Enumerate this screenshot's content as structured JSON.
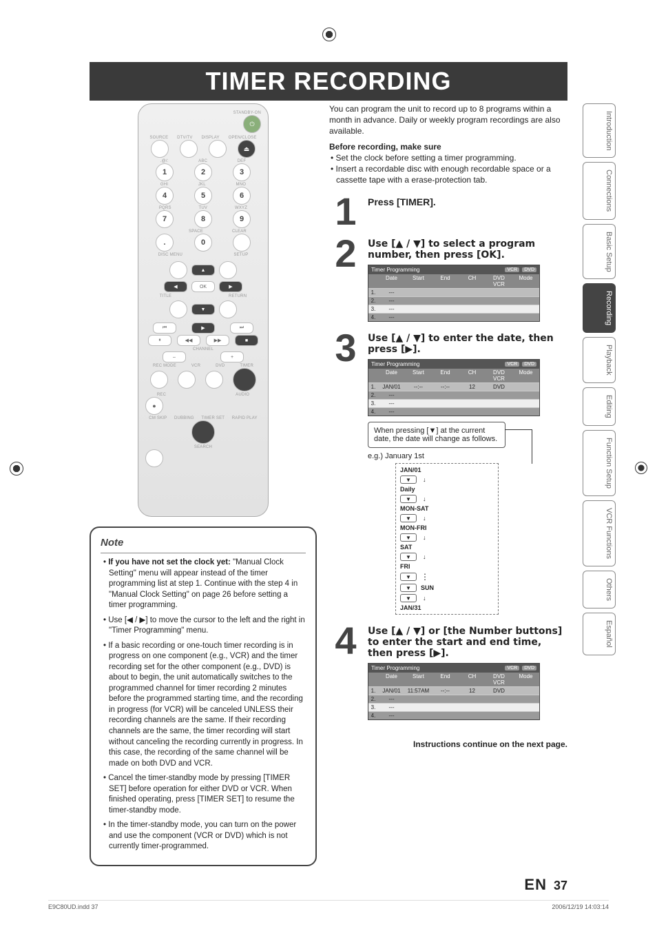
{
  "banner": {
    "title": "TIMER RECORDING"
  },
  "remote": {
    "labels": {
      "standby": "STANDBY-ON",
      "row1": [
        "SOURCE",
        "DTV/TV",
        "DISPLAY",
        "OPEN/CLOSE"
      ],
      "numrow1_lbl": [
        ".@/:",
        "ABC",
        "DEF"
      ],
      "numrow2_lbl": [
        "GHI",
        "JKL",
        "MNO"
      ],
      "numrow3_lbl": [
        "PQRS",
        "TUV",
        "WXYZ"
      ],
      "numrow4_lbl": [
        "",
        "SPACE",
        "CLEAR"
      ],
      "nums": [
        "1",
        "2",
        "3",
        "4",
        "5",
        "6",
        "7",
        "8",
        "9",
        ".",
        "0",
        ""
      ],
      "discmenu": "DISC MENU",
      "setup": "SETUP",
      "ok": "OK",
      "title": "TITLE",
      "return": "RETURN",
      "playrow": [
        "⏮",
        "▶",
        "⏭"
      ],
      "ctrlrow": [
        "⏸",
        "◀◀",
        "▶▶",
        "■"
      ],
      "channel": "CHANNEL",
      "minus": "–",
      "plus": "+",
      "recmode": "REC MODE",
      "vcr": "VCR",
      "dvd": "DVD",
      "timer": "TIMER",
      "rec": "REC",
      "audio": "AUDIO",
      "cmskip": "CM SKIP",
      "dubbing": "DUBBING",
      "timerset": "TIMER SET",
      "rapid": "RAPID PLAY",
      "search": "SEARCH"
    }
  },
  "note": {
    "heading": "Note",
    "bold1": "If you have not set the clock yet:",
    "item1": "\"Manual Clock Setting\" menu will appear instead of the timer programming list at step 1. Continue with the step 4 in \"Manual Clock Setting\" on page 26 before setting a timer programming.",
    "item2": "Use [◀ / ▶] to move the cursor to the left and the right in \"Timer Programming\" menu.",
    "item3": "If a basic recording or one-touch timer recording is in progress on one component (e.g., VCR) and the timer recording set for the other component (e.g., DVD) is about to begin, the unit automatically switches to the programmed channel for timer recording 2 minutes before the programmed starting time, and the recording in progress (for VCR) will be canceled UNLESS their recording channels are the same. If their recording channels are the same, the timer recording will start without canceling the recording currently in progress. In this case, the recording of the same channel will be made on both DVD and VCR.",
    "item4": "Cancel the timer-standby mode by pressing [TIMER SET] before operation for either DVD or VCR. When finished operating, press [TIMER SET] to resume the timer-standby mode.",
    "item5": "In the timer-standby mode, you can turn on the power and use the component (VCR or DVD) which is not currently timer-programmed."
  },
  "intro": {
    "p1": "You can program the unit to record up to 8 programs within a month in advance. Daily or weekly program recordings are also available.",
    "before_heading": "Before recording, make sure",
    "b1": "Set the clock before setting a timer programming.",
    "b2": "Insert a recordable disc with enough recordable space or a cassette tape with a erase-protection tab."
  },
  "steps": {
    "s1": {
      "num": "1",
      "title": "Press [TIMER]."
    },
    "s2": {
      "num": "2",
      "title": "Use [▲ / ▼] to select a program number, then press [OK]."
    },
    "s3": {
      "num": "3",
      "title": "Use [▲ / ▼] to enter the date, then press [▶].",
      "callout": "When pressing [▼] at the current date, the date will change as follows.",
      "eg": "e.g.) January 1st",
      "flow": [
        "JAN/01",
        "Daily",
        "MON-SAT",
        "MON-FRI",
        "SAT",
        "FRI",
        "SUN",
        "JAN/31"
      ]
    },
    "s4": {
      "num": "4",
      "title": "Use [▲ / ▼] or [the Number buttons] to enter the start and end time, then press [▶]."
    }
  },
  "tp": {
    "title": "Timer Programming",
    "vcr": "VCR",
    "dvd": "DVD",
    "cols": [
      "",
      "Date",
      "Start",
      "End",
      "CH",
      "DVD VCR",
      "Mode"
    ],
    "box2_rows": [
      [
        "1.",
        "---",
        "",
        "",
        "",
        "",
        ""
      ],
      [
        "2.",
        "---",
        "",
        "",
        "",
        "",
        ""
      ],
      [
        "3.",
        "---",
        "",
        "",
        "",
        "",
        ""
      ],
      [
        "4.",
        "---",
        "",
        "",
        "",
        "",
        ""
      ]
    ],
    "box3_rows": [
      [
        "1.",
        "JAN/01",
        "--:--",
        "--:--",
        "12",
        "DVD",
        ""
      ],
      [
        "2.",
        "---",
        "",
        "",
        "",
        "",
        ""
      ],
      [
        "3.",
        "---",
        "",
        "",
        "",
        "",
        ""
      ],
      [
        "4.",
        "---",
        "",
        "",
        "",
        "",
        ""
      ]
    ],
    "box4_rows": [
      [
        "1.",
        "JAN/01",
        "11:57AM",
        "--:--",
        "12",
        "DVD",
        ""
      ],
      [
        "2.",
        "---",
        "",
        "",
        "",
        "",
        ""
      ],
      [
        "3.",
        "---",
        "",
        "",
        "",
        "",
        ""
      ],
      [
        "4.",
        "---",
        "",
        "",
        "",
        "",
        ""
      ]
    ]
  },
  "continue_text": "Instructions continue on the next page.",
  "page": {
    "lang": "EN",
    "num": "37"
  },
  "footer": {
    "left": "E9C80UD.indd   37",
    "right": "2006/12/19   14:03:14"
  },
  "side_tabs": [
    "Introduction",
    "Connections",
    "Basic Setup",
    "Recording",
    "Playback",
    "Editing",
    "Function Setup",
    "VCR Functions",
    "Others",
    "Español"
  ],
  "active_tab_index": 3
}
